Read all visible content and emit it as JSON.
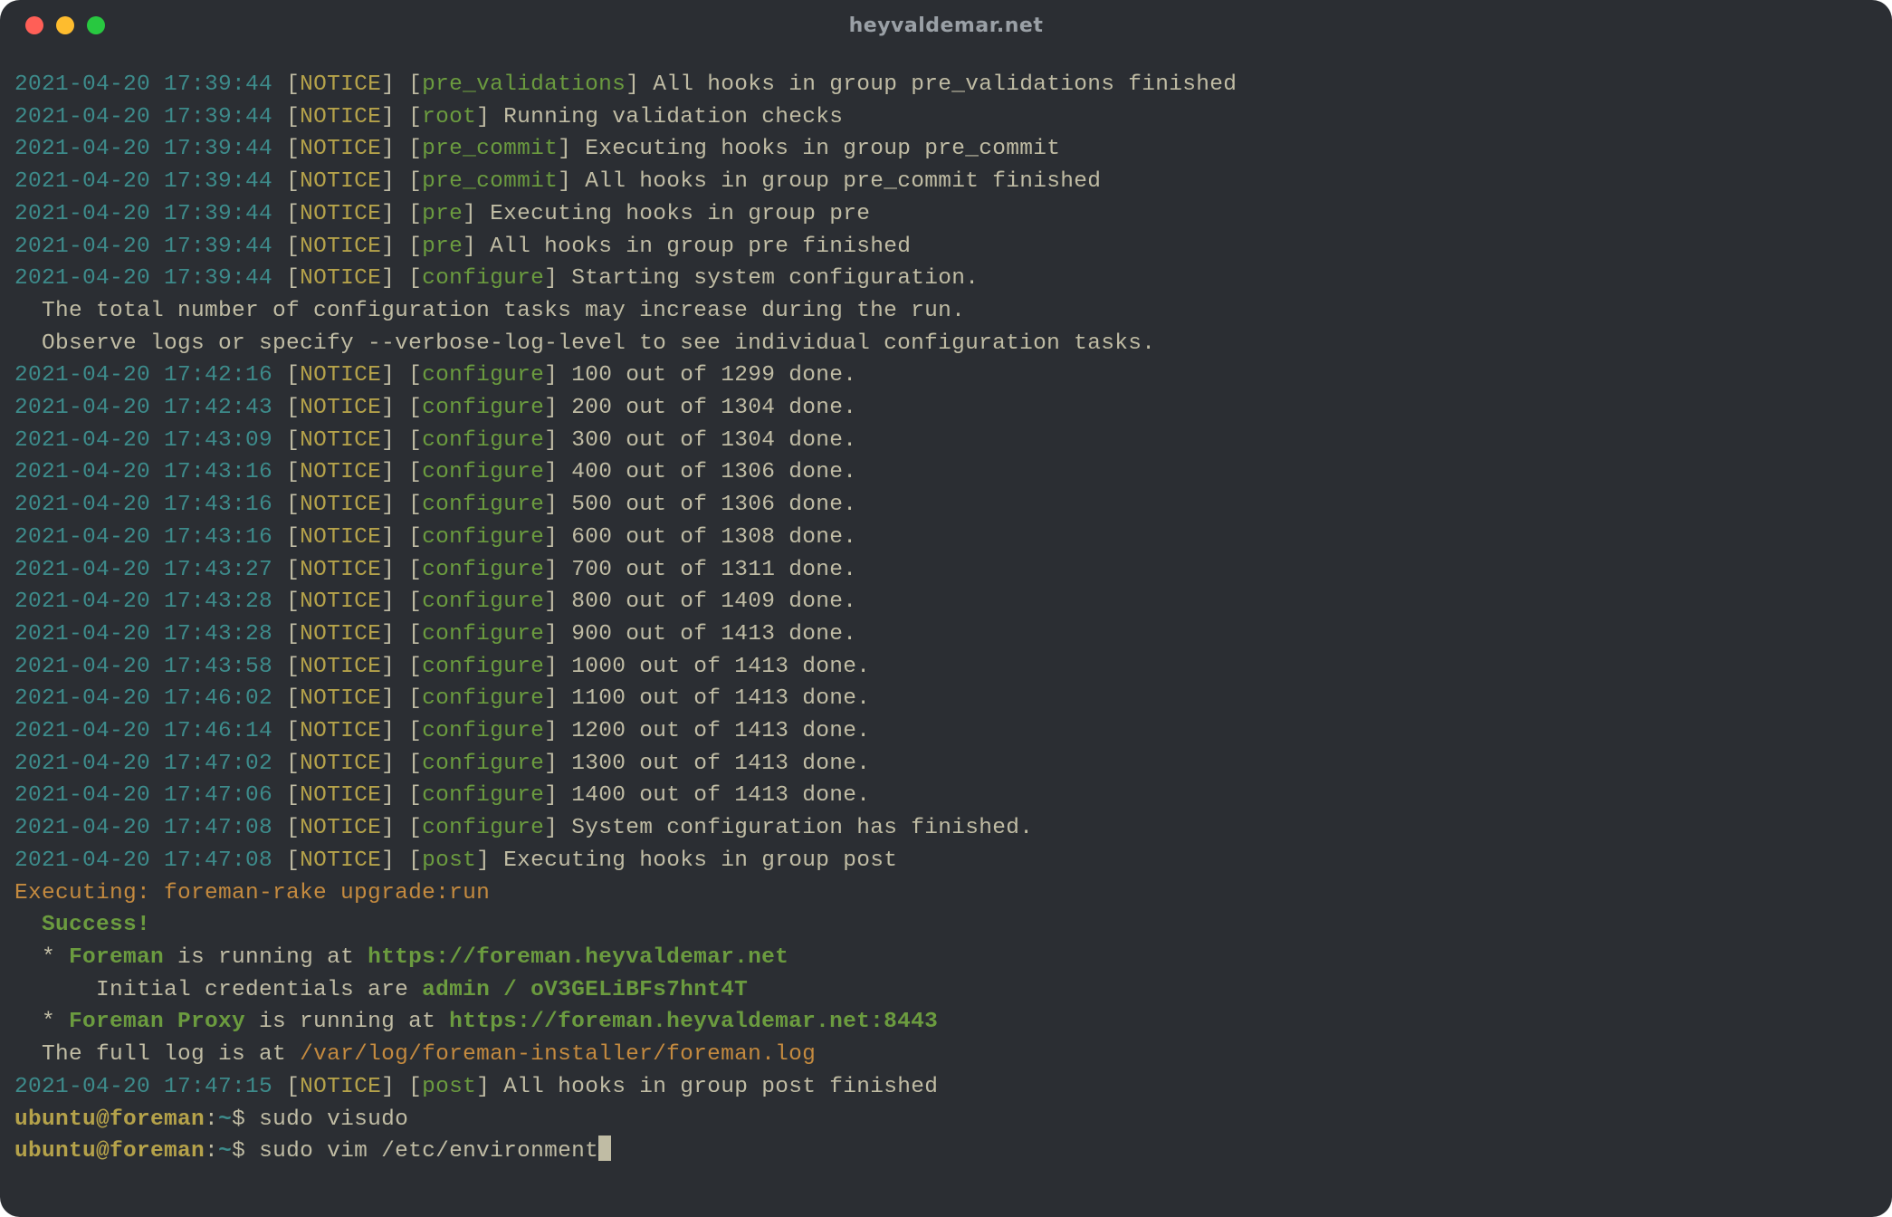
{
  "colors": {
    "bg": "#2b2e33",
    "timestamp": "#3d8b8b",
    "level": "#b5a24a",
    "bracket": "#c0bca4",
    "tag": "#6b9b3f",
    "text": "#c0bca4",
    "orange": "#c48a3f",
    "green": "#6b9b3f",
    "traffic_red": "#ff5f57",
    "traffic_yellow": "#febc2e",
    "traffic_green": "#28c840",
    "title": "#9aa0a6"
  },
  "window": {
    "title": "heyvaldemar.net"
  },
  "log_lines": [
    {
      "ts": "2021-04-20 17:39:44",
      "lvl": "NOTICE",
      "tag": "pre_validations",
      "msg": " All hooks in group pre_validations finished"
    },
    {
      "ts": "2021-04-20 17:39:44",
      "lvl": "NOTICE",
      "tag": "root",
      "msg": " Running validation checks"
    },
    {
      "ts": "2021-04-20 17:39:44",
      "lvl": "NOTICE",
      "tag": "pre_commit",
      "msg": " Executing hooks in group pre_commit"
    },
    {
      "ts": "2021-04-20 17:39:44",
      "lvl": "NOTICE",
      "tag": "pre_commit",
      "msg": " All hooks in group pre_commit finished"
    },
    {
      "ts": "2021-04-20 17:39:44",
      "lvl": "NOTICE",
      "tag": "pre",
      "msg": " Executing hooks in group pre"
    },
    {
      "ts": "2021-04-20 17:39:44",
      "lvl": "NOTICE",
      "tag": "pre",
      "msg": " All hooks in group pre finished"
    },
    {
      "ts": "2021-04-20 17:39:44",
      "lvl": "NOTICE",
      "tag": "configure",
      "msg": " Starting system configuration."
    }
  ],
  "info_lines": [
    "  The total number of configuration tasks may increase during the run.",
    "  Observe logs or specify --verbose-log-level to see individual configuration tasks."
  ],
  "progress_lines": [
    {
      "ts": "2021-04-20 17:42:16",
      "lvl": "NOTICE",
      "tag": "configure",
      "msg": " 100 out of 1299 done."
    },
    {
      "ts": "2021-04-20 17:42:43",
      "lvl": "NOTICE",
      "tag": "configure",
      "msg": " 200 out of 1304 done."
    },
    {
      "ts": "2021-04-20 17:43:09",
      "lvl": "NOTICE",
      "tag": "configure",
      "msg": " 300 out of 1304 done."
    },
    {
      "ts": "2021-04-20 17:43:16",
      "lvl": "NOTICE",
      "tag": "configure",
      "msg": " 400 out of 1306 done."
    },
    {
      "ts": "2021-04-20 17:43:16",
      "lvl": "NOTICE",
      "tag": "configure",
      "msg": " 500 out of 1306 done."
    },
    {
      "ts": "2021-04-20 17:43:16",
      "lvl": "NOTICE",
      "tag": "configure",
      "msg": " 600 out of 1308 done."
    },
    {
      "ts": "2021-04-20 17:43:27",
      "lvl": "NOTICE",
      "tag": "configure",
      "msg": " 700 out of 1311 done."
    },
    {
      "ts": "2021-04-20 17:43:28",
      "lvl": "NOTICE",
      "tag": "configure",
      "msg": " 800 out of 1409 done."
    },
    {
      "ts": "2021-04-20 17:43:28",
      "lvl": "NOTICE",
      "tag": "configure",
      "msg": " 900 out of 1413 done."
    },
    {
      "ts": "2021-04-20 17:43:58",
      "lvl": "NOTICE",
      "tag": "configure",
      "msg": " 1000 out of 1413 done."
    },
    {
      "ts": "2021-04-20 17:46:02",
      "lvl": "NOTICE",
      "tag": "configure",
      "msg": " 1100 out of 1413 done."
    },
    {
      "ts": "2021-04-20 17:46:14",
      "lvl": "NOTICE",
      "tag": "configure",
      "msg": " 1200 out of 1413 done."
    },
    {
      "ts": "2021-04-20 17:47:02",
      "lvl": "NOTICE",
      "tag": "configure",
      "msg": " 1300 out of 1413 done."
    },
    {
      "ts": "2021-04-20 17:47:06",
      "lvl": "NOTICE",
      "tag": "configure",
      "msg": " 1400 out of 1413 done."
    },
    {
      "ts": "2021-04-20 17:47:08",
      "lvl": "NOTICE",
      "tag": "configure",
      "msg": " System configuration has finished."
    },
    {
      "ts": "2021-04-20 17:47:08",
      "lvl": "NOTICE",
      "tag": "post",
      "msg": " Executing hooks in group post"
    }
  ],
  "exec_line": "Executing: foreman-rake upgrade:run",
  "success_label": "  Success!",
  "foreman": {
    "prefix": "  * ",
    "word": "Foreman",
    "running": " is running at ",
    "url": "https://foreman.heyvaldemar.net"
  },
  "creds": {
    "prefix": "      Initial credentials are ",
    "value": "admin / oV3GELiBFs7hnt4T"
  },
  "proxy": {
    "prefix": "  * ",
    "word": "Foreman Proxy",
    "running": " is running at ",
    "url": "https://foreman.heyvaldemar.net:8443"
  },
  "blank": "",
  "fulllog": {
    "prefix": "  The full log is at ",
    "path": "/var/log/foreman-installer/foreman.log"
  },
  "post_line": {
    "ts": "2021-04-20 17:47:15",
    "lvl": "NOTICE",
    "tag": "post",
    "msg": " All hooks in group post finished"
  },
  "prompts": [
    {
      "user": "ubuntu",
      "host": "foreman",
      "path": "~",
      "sym": "$",
      "cmd": " sudo visudo"
    },
    {
      "user": "ubuntu",
      "host": "foreman",
      "path": "~",
      "sym": "$",
      "cmd": " sudo vim /etc/environment"
    }
  ]
}
